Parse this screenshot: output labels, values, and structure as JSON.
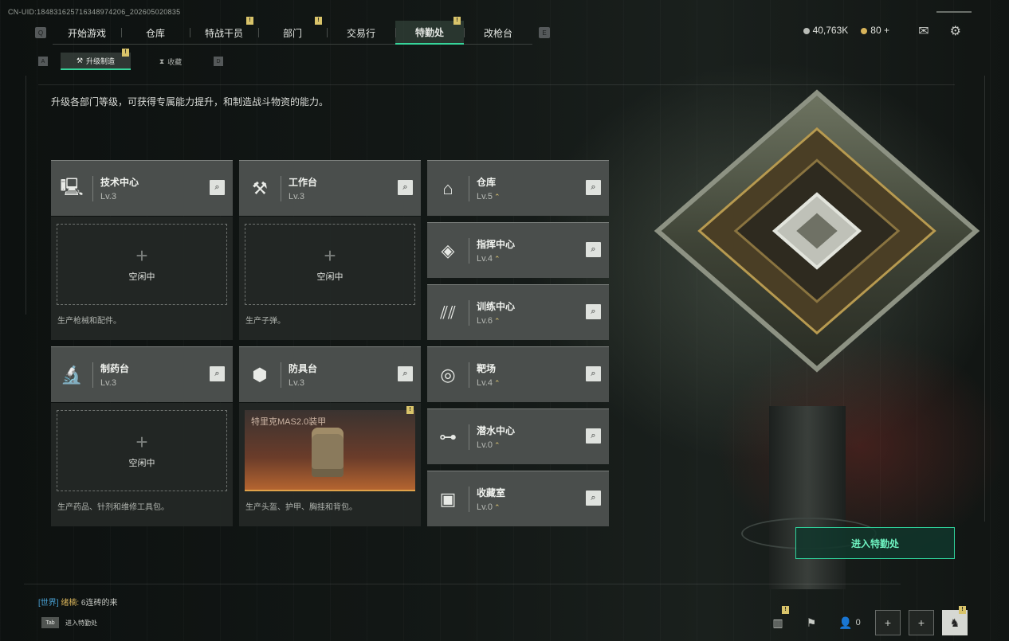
{
  "uid": "CN-UID:184831625716348974206_202605020835",
  "nav": {
    "left_key": "Q",
    "right_key": "E",
    "tabs": [
      {
        "label": "开始游戏",
        "badge": false,
        "active": false
      },
      {
        "label": "仓库",
        "badge": false,
        "active": false
      },
      {
        "label": "特战干员",
        "badge": true,
        "active": false
      },
      {
        "label": "部门",
        "badge": true,
        "active": false
      },
      {
        "label": "交易行",
        "badge": false,
        "active": false
      },
      {
        "label": "特勤处",
        "badge": true,
        "active": true
      },
      {
        "label": "改枪台",
        "badge": false,
        "active": false
      }
    ],
    "badge_text": "!"
  },
  "currency": {
    "silver": "40,763K",
    "gold": "80",
    "add": "+"
  },
  "subnav": {
    "left_key": "A",
    "right_key": "D",
    "tabs": [
      {
        "label": "升级制造",
        "active": true,
        "badge": true
      },
      {
        "label": "收藏",
        "active": false,
        "badge": false
      }
    ]
  },
  "description": "升级各部门等级，可获得专属能力提升，和制造战斗物资的能力。",
  "production": [
    {
      "name": "技术中心",
      "level": "Lv.3",
      "icon": "monitor-icon",
      "slot_state": "idle",
      "slot_plus": "+",
      "slot_text": "空闲中",
      "note": "生产枪械和配件。"
    },
    {
      "name": "工作台",
      "level": "Lv.3",
      "icon": "tools-icon",
      "slot_state": "idle",
      "slot_plus": "+",
      "slot_text": "空闲中",
      "note": "生产子弹。"
    },
    {
      "name": "制药台",
      "level": "Lv.3",
      "icon": "microscope-icon",
      "slot_state": "idle",
      "slot_plus": "+",
      "slot_text": "空闲中",
      "note": "生产药品、针剂和维修工具包。"
    },
    {
      "name": "防具台",
      "level": "Lv.3",
      "icon": "cubes-icon",
      "slot_state": "product",
      "product_name": "特里克MAS2.0装甲",
      "note": "生产头盔、护甲、胸挂和背包。"
    }
  ],
  "facilities": [
    {
      "name": "仓库",
      "level": "Lv.5",
      "icon": "warehouse-icon",
      "upgradable": true
    },
    {
      "name": "指挥中心",
      "level": "Lv.4",
      "icon": "command-icon",
      "upgradable": true
    },
    {
      "name": "训练中心",
      "level": "Lv.6",
      "icon": "dumbbell-icon",
      "upgradable": true
    },
    {
      "name": "靶场",
      "level": "Lv.4",
      "icon": "target-icon",
      "upgradable": true
    },
    {
      "name": "潜水中心",
      "level": "Lv.0",
      "icon": "diving-mask-icon",
      "upgradable": true
    },
    {
      "name": "收藏室",
      "level": "Lv.0",
      "icon": "collection-icon",
      "upgradable": true
    }
  ],
  "enter_button": "进入特勤处",
  "chat": {
    "channel": "[世界]",
    "user": "绪楠:",
    "message": "6连砖的来"
  },
  "tab_hint": {
    "key": "Tab",
    "label": "进入特勤处"
  },
  "bottom": {
    "friends_count": "0"
  },
  "colors": {
    "accent": "#36d49a",
    "badge": "#d9c46a",
    "upgrade": "#e0c873"
  }
}
